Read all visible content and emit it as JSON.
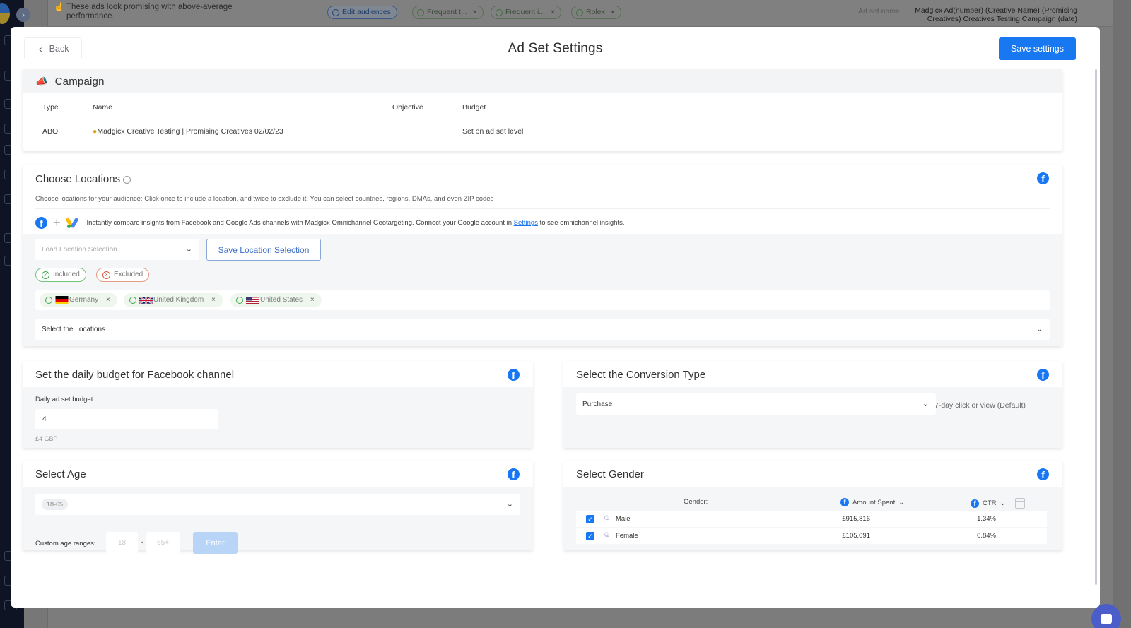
{
  "background": {
    "note": "These ads look promising with above-average performance.",
    "chips": [
      {
        "label": "Edit audiences",
        "kind": "edit"
      },
      {
        "label": "Frequent t...",
        "kind": "audience"
      },
      {
        "label": "Frequent i...",
        "kind": "audience"
      },
      {
        "label": "Rolex",
        "kind": "audience"
      }
    ],
    "ad_set_name_label": "Ad set name",
    "ad_set_name_value": "Madgicx Ad(number) (Creative Name) (Promising Creatives) Creatives Testing Campaign (date)"
  },
  "header": {
    "back_label": "Back",
    "title": "Ad Set Settings",
    "save_label": "Save settings"
  },
  "campaign": {
    "title": "Campaign",
    "columns": [
      "Type",
      "Name",
      "Objective",
      "Budget"
    ],
    "row": {
      "type": "ABO",
      "name": "Madgicx Creative Testing | Promising Creatives 02/02/23",
      "objective": "",
      "budget": "Set on ad set level"
    }
  },
  "locations": {
    "title": "Choose Locations",
    "description": "Choose locations for your audience: Click once to include a location, and twice to exclude it. You can select countries, regions, DMAs, and even ZIP codes",
    "omni_text_before": "Instantly compare insights from Facebook and Google Ads channels with Madgicx Omnichannel Geotargeting. Connect your Google account in",
    "omni_link": "Settings",
    "omni_text_after": "to see omnichannel insights.",
    "load_placeholder": "Load Location Selection",
    "save_selection_label": "Save Location Selection",
    "legend_included": "Included",
    "legend_excluded": "Excluded",
    "selected": [
      {
        "name": "Germany",
        "status": "included"
      },
      {
        "name": "United Kingdom",
        "status": "included"
      },
      {
        "name": "United States",
        "status": "included"
      }
    ],
    "select_placeholder": "Select the Locations"
  },
  "budget": {
    "title": "Set the daily budget for Facebook channel",
    "field_label": "Daily ad set budget:",
    "value": "4",
    "hint": "£4 GBP"
  },
  "conversion": {
    "title": "Select the Conversion Type",
    "selected": "Purchase",
    "attribution": "7-day click or view (Default)"
  },
  "age": {
    "title": "Select Age",
    "selected_range": "18-65",
    "custom_label": "Custom age ranges:",
    "min_placeholder": "18",
    "max_placeholder": "65+",
    "separator": "-",
    "enter_label": "Enter"
  },
  "gender": {
    "title": "Select Gender",
    "col_gender": "Gender:",
    "col_amount": "Amount Spent",
    "col_ctr": "CTR",
    "rows": [
      {
        "name": "Male",
        "checked": true,
        "amount": "£915,816",
        "ctr": "1.34%"
      },
      {
        "name": "Female",
        "checked": true,
        "amount": "£105,091",
        "ctr": "0.84%"
      }
    ]
  },
  "colors": {
    "primary": "#1778f2",
    "facebook": "#1877f2",
    "included": "#3aa54a",
    "excluded": "#d9593a"
  }
}
